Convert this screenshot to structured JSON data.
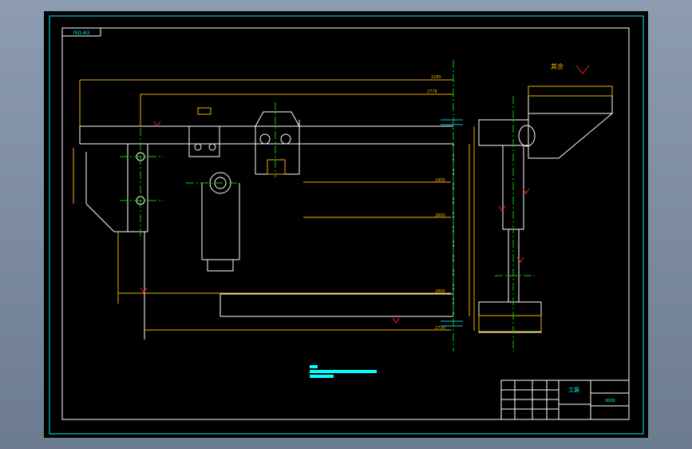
{
  "drawing": {
    "frame_tag": "ISO-A3",
    "roughness_note": "其余",
    "dimensions": [
      "2280",
      "2778",
      "1800",
      "2800",
      "2800",
      "2730"
    ],
    "title_block": {
      "title": "工装",
      "code": "0000"
    },
    "colors": {
      "background": "#000000",
      "frame": "#ffffff",
      "outer_border": "#00c8d8",
      "dimension": "#f0b000",
      "centerline": "#00d000",
      "annotation": "#ff2020",
      "notes": "#00ffff"
    }
  }
}
